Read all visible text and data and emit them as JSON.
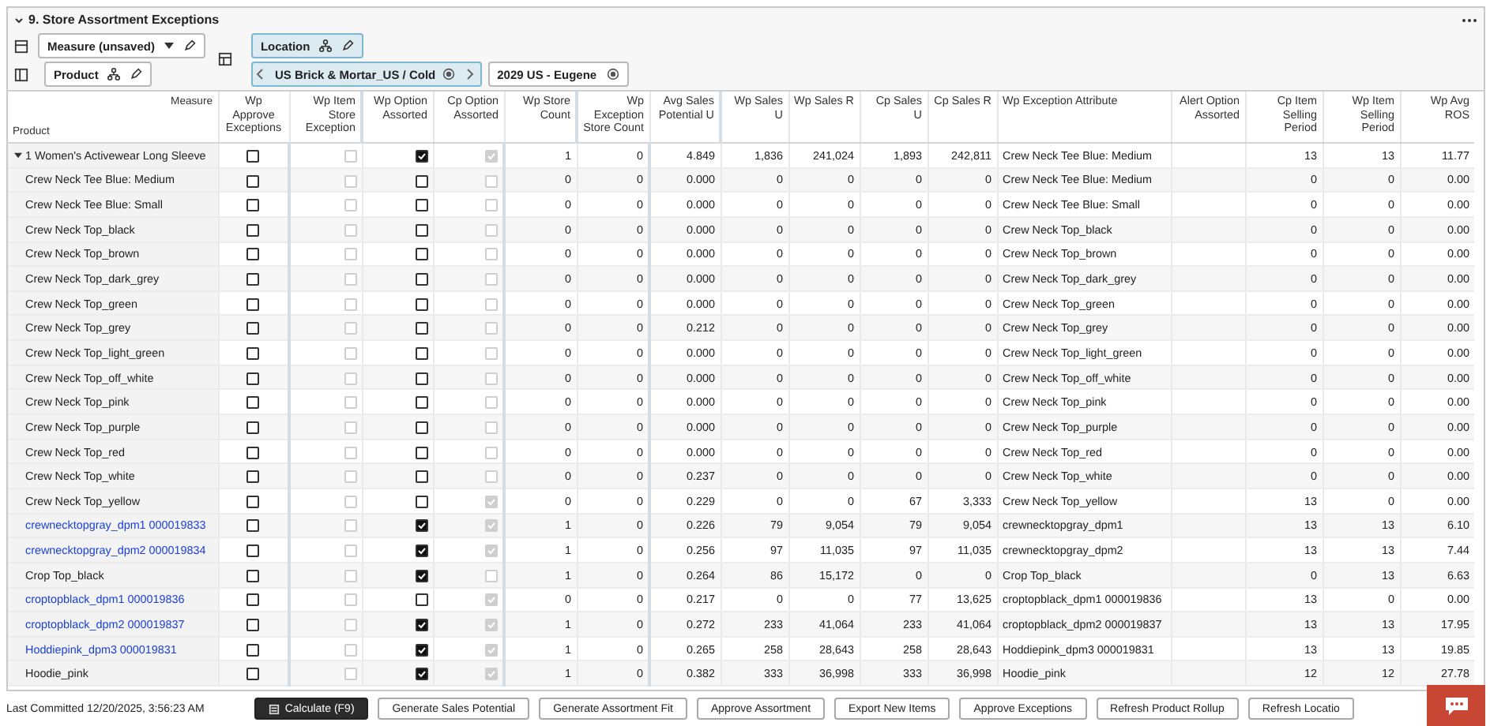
{
  "panel": {
    "title": "9. Store Assortment Exceptions",
    "expanded": true
  },
  "toolbar": {
    "measure": "Measure (unsaved)",
    "product": "Product",
    "location": "Location",
    "location_path": "US Brick & Mortar_US / Cold",
    "store": "2029 US - Eugene"
  },
  "table": {
    "corner_measure": "Measure",
    "corner_product": "Product",
    "columns": [
      "Wp Approve Exceptions",
      "Wp Item Store Exception",
      "Wp Option Assorted",
      "Cp Option Assorted",
      "Wp Store Count",
      "Wp Exception Store Count",
      "Avg Sales Potential U",
      "Wp Sales U",
      "Wp Sales R",
      "Cp Sales U",
      "Cp Sales R",
      "Wp Exception Attribute",
      "Alert Option Assorted",
      "Cp Item Selling Period",
      "Wp Item Selling Period",
      "Wp Avg ROS"
    ],
    "rows": [
      {
        "kind": "group",
        "expanded": true,
        "product": "1 Women's Activewear Long Sleeve",
        "approve": false,
        "item_exception": false,
        "wp_assorted": true,
        "cp_assorted": true,
        "values": [
          "1",
          "0",
          "4.849",
          "1,836",
          "241,024",
          "1,893",
          "242,811"
        ],
        "attribute": "Crew Neck Tee Blue: Medium",
        "tail": [
          "13",
          "13",
          "11.77"
        ]
      },
      {
        "kind": "item",
        "product": "Crew Neck Tee Blue: Medium",
        "approve": false,
        "item_exception": false,
        "wp_assorted": false,
        "cp_assorted": false,
        "values": [
          "0",
          "0",
          "0.000",
          "0",
          "0",
          "0",
          "0"
        ],
        "attribute": "Crew Neck Tee Blue: Medium",
        "tail": [
          "0",
          "0",
          "0.00"
        ]
      },
      {
        "kind": "item",
        "product": "Crew Neck Tee Blue: Small",
        "approve": false,
        "item_exception": false,
        "wp_assorted": false,
        "cp_assorted": false,
        "values": [
          "0",
          "0",
          "0.000",
          "0",
          "0",
          "0",
          "0"
        ],
        "attribute": "Crew Neck Tee Blue: Small",
        "tail": [
          "0",
          "0",
          "0.00"
        ]
      },
      {
        "kind": "item",
        "product": "Crew Neck Top_black",
        "approve": false,
        "item_exception": false,
        "wp_assorted": false,
        "cp_assorted": false,
        "values": [
          "0",
          "0",
          "0.000",
          "0",
          "0",
          "0",
          "0"
        ],
        "attribute": "Crew Neck Top_black",
        "tail": [
          "0",
          "0",
          "0.00"
        ]
      },
      {
        "kind": "item",
        "product": "Crew Neck Top_brown",
        "approve": false,
        "item_exception": false,
        "wp_assorted": false,
        "cp_assorted": false,
        "values": [
          "0",
          "0",
          "0.000",
          "0",
          "0",
          "0",
          "0"
        ],
        "attribute": "Crew Neck Top_brown",
        "tail": [
          "0",
          "0",
          "0.00"
        ]
      },
      {
        "kind": "item",
        "product": "Crew Neck Top_dark_grey",
        "approve": false,
        "item_exception": false,
        "wp_assorted": false,
        "cp_assorted": false,
        "values": [
          "0",
          "0",
          "0.000",
          "0",
          "0",
          "0",
          "0"
        ],
        "attribute": "Crew Neck Top_dark_grey",
        "tail": [
          "0",
          "0",
          "0.00"
        ]
      },
      {
        "kind": "item",
        "product": "Crew Neck Top_green",
        "approve": false,
        "item_exception": false,
        "wp_assorted": false,
        "cp_assorted": false,
        "values": [
          "0",
          "0",
          "0.000",
          "0",
          "0",
          "0",
          "0"
        ],
        "attribute": "Crew Neck Top_green",
        "tail": [
          "0",
          "0",
          "0.00"
        ]
      },
      {
        "kind": "item",
        "product": "Crew Neck Top_grey",
        "approve": false,
        "item_exception": false,
        "wp_assorted": false,
        "cp_assorted": false,
        "values": [
          "0",
          "0",
          "0.212",
          "0",
          "0",
          "0",
          "0"
        ],
        "attribute": "Crew Neck Top_grey",
        "tail": [
          "0",
          "0",
          "0.00"
        ]
      },
      {
        "kind": "item",
        "product": "Crew Neck Top_light_green",
        "approve": false,
        "item_exception": false,
        "wp_assorted": false,
        "cp_assorted": false,
        "values": [
          "0",
          "0",
          "0.000",
          "0",
          "0",
          "0",
          "0"
        ],
        "attribute": "Crew Neck Top_light_green",
        "tail": [
          "0",
          "0",
          "0.00"
        ]
      },
      {
        "kind": "item",
        "product": "Crew Neck Top_off_white",
        "approve": false,
        "item_exception": false,
        "wp_assorted": false,
        "cp_assorted": false,
        "values": [
          "0",
          "0",
          "0.000",
          "0",
          "0",
          "0",
          "0"
        ],
        "attribute": "Crew Neck Top_off_white",
        "tail": [
          "0",
          "0",
          "0.00"
        ]
      },
      {
        "kind": "item",
        "product": "Crew Neck Top_pink",
        "approve": false,
        "item_exception": false,
        "wp_assorted": false,
        "cp_assorted": false,
        "values": [
          "0",
          "0",
          "0.000",
          "0",
          "0",
          "0",
          "0"
        ],
        "attribute": "Crew Neck Top_pink",
        "tail": [
          "0",
          "0",
          "0.00"
        ]
      },
      {
        "kind": "item",
        "product": "Crew Neck Top_purple",
        "approve": false,
        "item_exception": false,
        "wp_assorted": false,
        "cp_assorted": false,
        "values": [
          "0",
          "0",
          "0.000",
          "0",
          "0",
          "0",
          "0"
        ],
        "attribute": "Crew Neck Top_purple",
        "tail": [
          "0",
          "0",
          "0.00"
        ]
      },
      {
        "kind": "item",
        "product": "Crew Neck Top_red",
        "approve": false,
        "item_exception": false,
        "wp_assorted": false,
        "cp_assorted": false,
        "values": [
          "0",
          "0",
          "0.000",
          "0",
          "0",
          "0",
          "0"
        ],
        "attribute": "Crew Neck Top_red",
        "tail": [
          "0",
          "0",
          "0.00"
        ]
      },
      {
        "kind": "item",
        "product": "Crew Neck Top_white",
        "approve": false,
        "item_exception": false,
        "wp_assorted": false,
        "cp_assorted": false,
        "values": [
          "0",
          "0",
          "0.237",
          "0",
          "0",
          "0",
          "0"
        ],
        "attribute": "Crew Neck Top_white",
        "tail": [
          "0",
          "0",
          "0.00"
        ]
      },
      {
        "kind": "item",
        "product": "Crew Neck Top_yellow",
        "approve": false,
        "item_exception": false,
        "wp_assorted": false,
        "cp_assorted": true,
        "values": [
          "0",
          "0",
          "0.229",
          "0",
          "0",
          "67",
          "3,333"
        ],
        "attribute": "Crew Neck Top_yellow",
        "tail": [
          "13",
          "0",
          "0.00"
        ]
      },
      {
        "kind": "link",
        "product": "crewnecktopgray_dpm1 000019833",
        "approve": false,
        "item_exception": false,
        "wp_assorted": true,
        "cp_assorted": true,
        "values": [
          "1",
          "0",
          "0.226",
          "79",
          "9,054",
          "79",
          "9,054"
        ],
        "attribute": "crewnecktopgray_dpm1",
        "tail": [
          "13",
          "13",
          "6.10"
        ]
      },
      {
        "kind": "link",
        "product": "crewnecktopgray_dpm2 000019834",
        "approve": false,
        "item_exception": false,
        "wp_assorted": true,
        "cp_assorted": true,
        "values": [
          "1",
          "0",
          "0.256",
          "97",
          "11,035",
          "97",
          "11,035"
        ],
        "attribute": "crewnecktopgray_dpm2",
        "tail": [
          "13",
          "13",
          "7.44"
        ]
      },
      {
        "kind": "item",
        "product": "Crop Top_black",
        "approve": false,
        "item_exception": false,
        "wp_assorted": true,
        "cp_assorted": false,
        "values": [
          "1",
          "0",
          "0.264",
          "86",
          "15,172",
          "0",
          "0"
        ],
        "attribute": "Crop Top_black",
        "tail": [
          "0",
          "13",
          "6.63"
        ]
      },
      {
        "kind": "link",
        "product": "croptopblack_dpm1 000019836",
        "approve": false,
        "item_exception": false,
        "wp_assorted": false,
        "cp_assorted": true,
        "values": [
          "0",
          "0",
          "0.217",
          "0",
          "0",
          "77",
          "13,625"
        ],
        "attribute": "croptopblack_dpm1 000019836",
        "tail": [
          "13",
          "0",
          "0.00"
        ]
      },
      {
        "kind": "link",
        "product": "croptopblack_dpm2 000019837",
        "approve": false,
        "item_exception": false,
        "wp_assorted": true,
        "cp_assorted": true,
        "values": [
          "1",
          "0",
          "0.272",
          "233",
          "41,064",
          "233",
          "41,064"
        ],
        "attribute": "croptopblack_dpm2 000019837",
        "tail": [
          "13",
          "13",
          "17.95"
        ]
      },
      {
        "kind": "link",
        "product": "Hoddiepink_dpm3 000019831",
        "approve": false,
        "item_exception": false,
        "wp_assorted": true,
        "cp_assorted": true,
        "values": [
          "1",
          "0",
          "0.265",
          "258",
          "28,643",
          "258",
          "28,643"
        ],
        "attribute": "Hoddiepink_dpm3 000019831",
        "tail": [
          "13",
          "13",
          "19.85"
        ]
      },
      {
        "kind": "item",
        "product": "Hoodie_pink",
        "approve": false,
        "item_exception": false,
        "wp_assorted": true,
        "cp_assorted": true,
        "values": [
          "1",
          "0",
          "0.382",
          "333",
          "36,998",
          "333",
          "36,998"
        ],
        "attribute": "Hoodie_pink",
        "tail": [
          "12",
          "12",
          "27.78"
        ]
      }
    ]
  },
  "footer": {
    "status": "Last Committed 12/20/2025, 3:56:23 AM",
    "buttons": [
      {
        "label": "Calculate (F9)",
        "kind": "primary"
      },
      {
        "label": "Generate Sales Potential",
        "kind": "normal"
      },
      {
        "label": "Generate Assortment Fit",
        "kind": "normal"
      },
      {
        "label": "Approve Assortment",
        "kind": "normal"
      },
      {
        "label": "Export New Items",
        "kind": "normal"
      },
      {
        "label": "Approve Exceptions",
        "kind": "normal"
      },
      {
        "label": "Refresh Product Rollup",
        "kind": "normal"
      },
      {
        "label": "Refresh Locatio",
        "kind": "normal"
      }
    ]
  }
}
